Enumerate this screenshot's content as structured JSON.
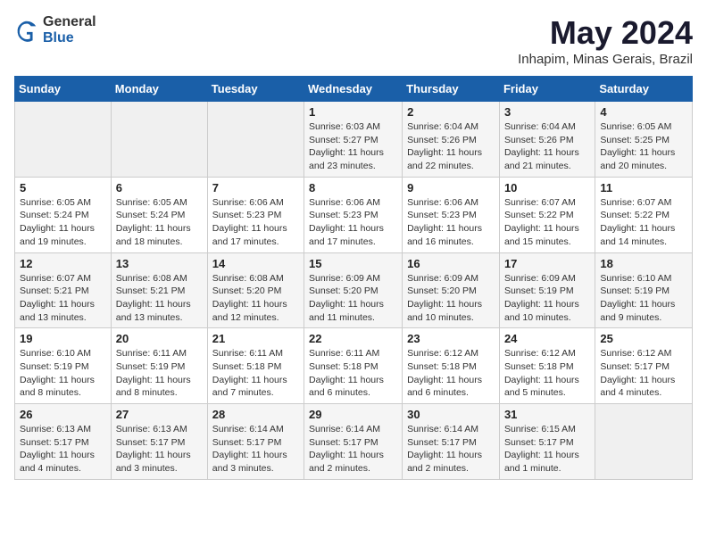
{
  "logo": {
    "general": "General",
    "blue": "Blue"
  },
  "header": {
    "month_year": "May 2024",
    "location": "Inhapim, Minas Gerais, Brazil"
  },
  "weekdays": [
    "Sunday",
    "Monday",
    "Tuesday",
    "Wednesday",
    "Thursday",
    "Friday",
    "Saturday"
  ],
  "weeks": [
    [
      {
        "day": "",
        "sunrise": "",
        "sunset": "",
        "daylight": ""
      },
      {
        "day": "",
        "sunrise": "",
        "sunset": "",
        "daylight": ""
      },
      {
        "day": "",
        "sunrise": "",
        "sunset": "",
        "daylight": ""
      },
      {
        "day": "1",
        "sunrise": "Sunrise: 6:03 AM",
        "sunset": "Sunset: 5:27 PM",
        "daylight": "Daylight: 11 hours and 23 minutes."
      },
      {
        "day": "2",
        "sunrise": "Sunrise: 6:04 AM",
        "sunset": "Sunset: 5:26 PM",
        "daylight": "Daylight: 11 hours and 22 minutes."
      },
      {
        "day": "3",
        "sunrise": "Sunrise: 6:04 AM",
        "sunset": "Sunset: 5:26 PM",
        "daylight": "Daylight: 11 hours and 21 minutes."
      },
      {
        "day": "4",
        "sunrise": "Sunrise: 6:05 AM",
        "sunset": "Sunset: 5:25 PM",
        "daylight": "Daylight: 11 hours and 20 minutes."
      }
    ],
    [
      {
        "day": "5",
        "sunrise": "Sunrise: 6:05 AM",
        "sunset": "Sunset: 5:24 PM",
        "daylight": "Daylight: 11 hours and 19 minutes."
      },
      {
        "day": "6",
        "sunrise": "Sunrise: 6:05 AM",
        "sunset": "Sunset: 5:24 PM",
        "daylight": "Daylight: 11 hours and 18 minutes."
      },
      {
        "day": "7",
        "sunrise": "Sunrise: 6:06 AM",
        "sunset": "Sunset: 5:23 PM",
        "daylight": "Daylight: 11 hours and 17 minutes."
      },
      {
        "day": "8",
        "sunrise": "Sunrise: 6:06 AM",
        "sunset": "Sunset: 5:23 PM",
        "daylight": "Daylight: 11 hours and 17 minutes."
      },
      {
        "day": "9",
        "sunrise": "Sunrise: 6:06 AM",
        "sunset": "Sunset: 5:23 PM",
        "daylight": "Daylight: 11 hours and 16 minutes."
      },
      {
        "day": "10",
        "sunrise": "Sunrise: 6:07 AM",
        "sunset": "Sunset: 5:22 PM",
        "daylight": "Daylight: 11 hours and 15 minutes."
      },
      {
        "day": "11",
        "sunrise": "Sunrise: 6:07 AM",
        "sunset": "Sunset: 5:22 PM",
        "daylight": "Daylight: 11 hours and 14 minutes."
      }
    ],
    [
      {
        "day": "12",
        "sunrise": "Sunrise: 6:07 AM",
        "sunset": "Sunset: 5:21 PM",
        "daylight": "Daylight: 11 hours and 13 minutes."
      },
      {
        "day": "13",
        "sunrise": "Sunrise: 6:08 AM",
        "sunset": "Sunset: 5:21 PM",
        "daylight": "Daylight: 11 hours and 13 minutes."
      },
      {
        "day": "14",
        "sunrise": "Sunrise: 6:08 AM",
        "sunset": "Sunset: 5:20 PM",
        "daylight": "Daylight: 11 hours and 12 minutes."
      },
      {
        "day": "15",
        "sunrise": "Sunrise: 6:09 AM",
        "sunset": "Sunset: 5:20 PM",
        "daylight": "Daylight: 11 hours and 11 minutes."
      },
      {
        "day": "16",
        "sunrise": "Sunrise: 6:09 AM",
        "sunset": "Sunset: 5:20 PM",
        "daylight": "Daylight: 11 hours and 10 minutes."
      },
      {
        "day": "17",
        "sunrise": "Sunrise: 6:09 AM",
        "sunset": "Sunset: 5:19 PM",
        "daylight": "Daylight: 11 hours and 10 minutes."
      },
      {
        "day": "18",
        "sunrise": "Sunrise: 6:10 AM",
        "sunset": "Sunset: 5:19 PM",
        "daylight": "Daylight: 11 hours and 9 minutes."
      }
    ],
    [
      {
        "day": "19",
        "sunrise": "Sunrise: 6:10 AM",
        "sunset": "Sunset: 5:19 PM",
        "daylight": "Daylight: 11 hours and 8 minutes."
      },
      {
        "day": "20",
        "sunrise": "Sunrise: 6:11 AM",
        "sunset": "Sunset: 5:19 PM",
        "daylight": "Daylight: 11 hours and 8 minutes."
      },
      {
        "day": "21",
        "sunrise": "Sunrise: 6:11 AM",
        "sunset": "Sunset: 5:18 PM",
        "daylight": "Daylight: 11 hours and 7 minutes."
      },
      {
        "day": "22",
        "sunrise": "Sunrise: 6:11 AM",
        "sunset": "Sunset: 5:18 PM",
        "daylight": "Daylight: 11 hours and 6 minutes."
      },
      {
        "day": "23",
        "sunrise": "Sunrise: 6:12 AM",
        "sunset": "Sunset: 5:18 PM",
        "daylight": "Daylight: 11 hours and 6 minutes."
      },
      {
        "day": "24",
        "sunrise": "Sunrise: 6:12 AM",
        "sunset": "Sunset: 5:18 PM",
        "daylight": "Daylight: 11 hours and 5 minutes."
      },
      {
        "day": "25",
        "sunrise": "Sunrise: 6:12 AM",
        "sunset": "Sunset: 5:17 PM",
        "daylight": "Daylight: 11 hours and 4 minutes."
      }
    ],
    [
      {
        "day": "26",
        "sunrise": "Sunrise: 6:13 AM",
        "sunset": "Sunset: 5:17 PM",
        "daylight": "Daylight: 11 hours and 4 minutes."
      },
      {
        "day": "27",
        "sunrise": "Sunrise: 6:13 AM",
        "sunset": "Sunset: 5:17 PM",
        "daylight": "Daylight: 11 hours and 3 minutes."
      },
      {
        "day": "28",
        "sunrise": "Sunrise: 6:14 AM",
        "sunset": "Sunset: 5:17 PM",
        "daylight": "Daylight: 11 hours and 3 minutes."
      },
      {
        "day": "29",
        "sunrise": "Sunrise: 6:14 AM",
        "sunset": "Sunset: 5:17 PM",
        "daylight": "Daylight: 11 hours and 2 minutes."
      },
      {
        "day": "30",
        "sunrise": "Sunrise: 6:14 AM",
        "sunset": "Sunset: 5:17 PM",
        "daylight": "Daylight: 11 hours and 2 minutes."
      },
      {
        "day": "31",
        "sunrise": "Sunrise: 6:15 AM",
        "sunset": "Sunset: 5:17 PM",
        "daylight": "Daylight: 11 hours and 1 minute."
      },
      {
        "day": "",
        "sunrise": "",
        "sunset": "",
        "daylight": ""
      }
    ]
  ]
}
